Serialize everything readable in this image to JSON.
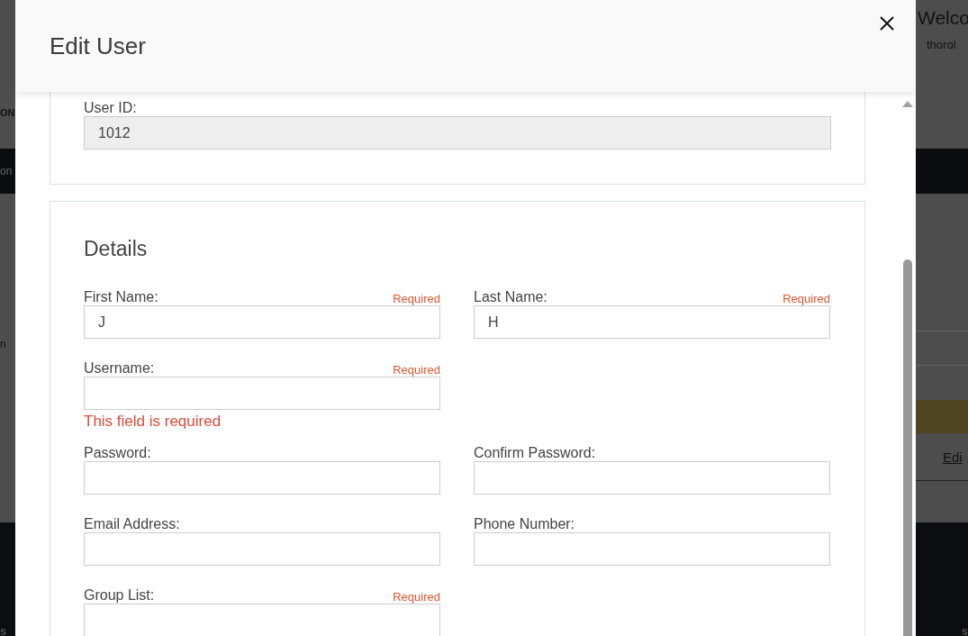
{
  "background_page": {
    "header_left": "ON",
    "header_title": "Welco",
    "header_user": "thorol",
    "nav_item": "on",
    "content_text": "n",
    "edit_link": "Edi",
    "footer_left": "s",
    "footer_right": "s"
  },
  "dialog": {
    "title": "Edit User",
    "id_section": {
      "field": {
        "label": "User ID:",
        "value": "1012",
        "disabled": true
      }
    },
    "details": {
      "title": "Details",
      "rows": [
        [
          {
            "label": "First Name:",
            "required": "Required",
            "value": "J"
          },
          {
            "label": "Last Name:",
            "required": "Required",
            "value": "H"
          }
        ],
        [
          {
            "label": "Username:",
            "required": "Required",
            "error": "This field is required"
          }
        ],
        [
          {
            "label": "Password:"
          },
          {
            "label": "Confirm Password:"
          }
        ],
        [
          {
            "label": "Email Address:"
          },
          {
            "label": "Phone Number:"
          }
        ],
        [
          {
            "label": "Group List:",
            "required": "Required"
          }
        ]
      ]
    }
  }
}
